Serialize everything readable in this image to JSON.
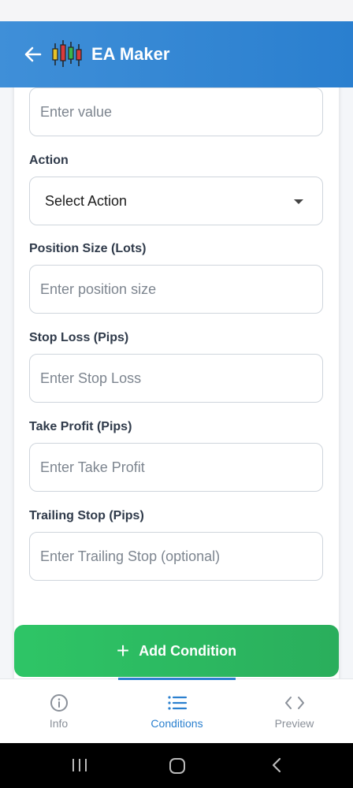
{
  "header": {
    "title": "EA Maker"
  },
  "form": {
    "value_placeholder": "Enter value",
    "action_label": "Action",
    "action_selected": "Select Action",
    "position_size_label": "Position Size (Lots)",
    "position_size_placeholder": "Enter position size",
    "stop_loss_label": "Stop Loss (Pips)",
    "stop_loss_placeholder": "Enter Stop Loss",
    "take_profit_label": "Take Profit (Pips)",
    "take_profit_placeholder": "Enter Take Profit",
    "trailing_stop_label": "Trailing Stop (Pips)",
    "trailing_stop_placeholder": "Enter Trailing Stop (optional)"
  },
  "add_condition": {
    "label": "Add Condition"
  },
  "bottom_nav": {
    "tabs": [
      {
        "label": "Info",
        "icon": "info-icon",
        "active": false
      },
      {
        "label": "Conditions",
        "icon": "list-icon",
        "active": true
      },
      {
        "label": "Preview",
        "icon": "code-icon",
        "active": false
      }
    ]
  },
  "colors": {
    "header": "#3f8fd8",
    "accent": "#2b80cf",
    "button_green": "#2ec566"
  }
}
